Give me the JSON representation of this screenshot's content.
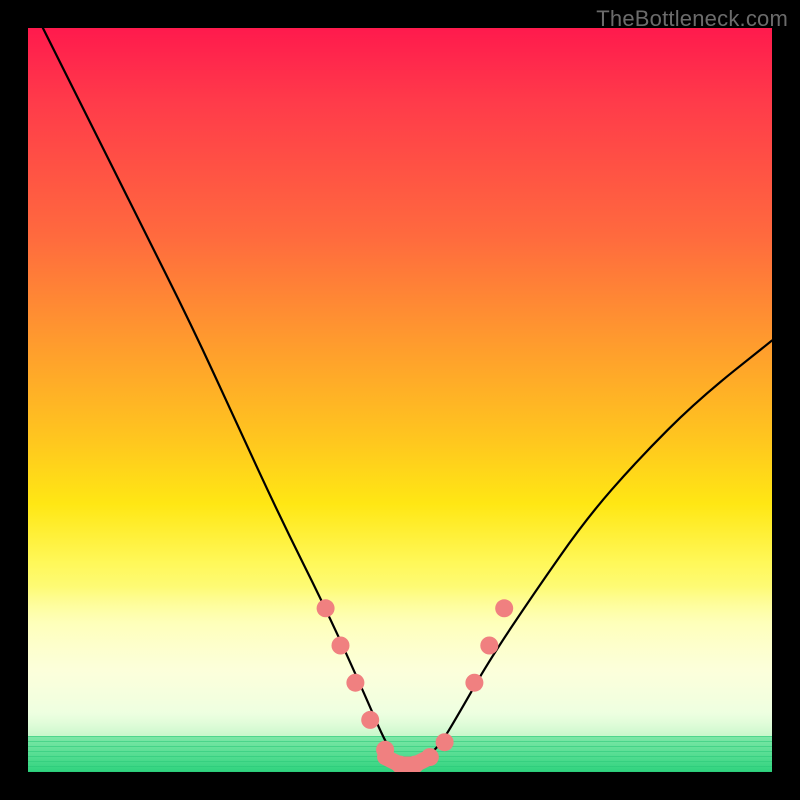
{
  "watermark": "TheBottleneck.com",
  "gradient": {
    "top": "#ff1a4d",
    "mid_upper": "#ff9a2e",
    "mid_lower": "#ffe714",
    "pale": "#fdff9e",
    "bottom": "#2fd37e"
  },
  "chart_data": {
    "type": "line",
    "title": "",
    "xlabel": "",
    "ylabel": "",
    "xlim": [
      0,
      100
    ],
    "ylim": [
      0,
      100
    ],
    "grid": false,
    "legend": false,
    "series": [
      {
        "name": "curve",
        "color": "#000000",
        "x": [
          2,
          8,
          15,
          22,
          28,
          34,
          40,
          45,
          48,
          50,
          52,
          55,
          58,
          62,
          68,
          75,
          82,
          90,
          100
        ],
        "y": [
          100,
          88,
          74,
          60,
          47,
          34,
          22,
          11,
          4,
          1,
          1,
          3,
          8,
          15,
          24,
          34,
          42,
          50,
          58
        ]
      },
      {
        "name": "marker-band",
        "color": "#f08080",
        "type": "scatter",
        "x": [
          40,
          42,
          44,
          46,
          48,
          50,
          52,
          54,
          56,
          60,
          62,
          64
        ],
        "y": [
          22,
          17,
          12,
          7,
          3,
          1,
          1,
          2,
          4,
          12,
          17,
          22
        ]
      }
    ],
    "annotations": []
  }
}
